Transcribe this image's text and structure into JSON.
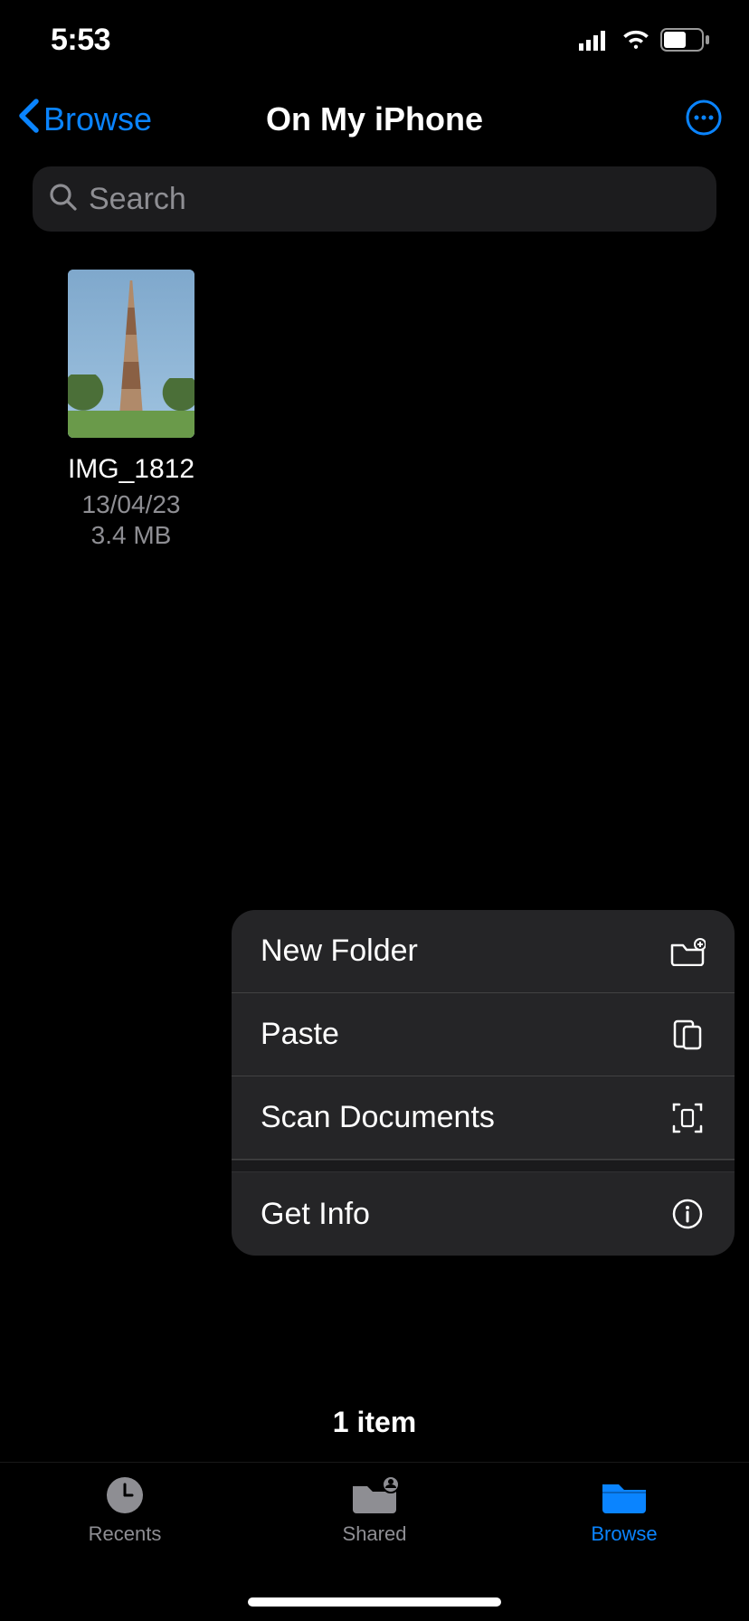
{
  "status": {
    "time": "5:53"
  },
  "nav": {
    "back": "Browse",
    "title": "On My iPhone"
  },
  "search": {
    "placeholder": "Search"
  },
  "files": [
    {
      "name": "IMG_1812",
      "date": "13/04/23",
      "size": "3.4 MB"
    }
  ],
  "menu": {
    "new_folder": "New Folder",
    "paste": "Paste",
    "scan": "Scan Documents",
    "info": "Get Info"
  },
  "footer": {
    "count": "1 item"
  },
  "tabs": {
    "recents": "Recents",
    "shared": "Shared",
    "browse": "Browse"
  },
  "colors": {
    "accent": "#0a84ff"
  }
}
